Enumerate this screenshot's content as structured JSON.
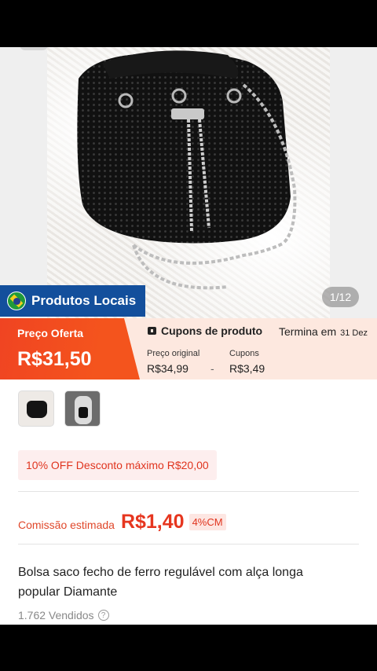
{
  "product_image": {
    "counter": "1/12",
    "local_label": "Produtos Locais",
    "flag_icon": "brazil-flag-icon"
  },
  "offer": {
    "label": "Preço Oferta",
    "price": "R$31,50",
    "coupon_title": "Cupons de produto",
    "ends_label": "Termina em",
    "ends_date": "31 Dez",
    "original_label": "Preço original",
    "original_value": "R$34,99",
    "separator": "-",
    "coupons_label": "Cupons",
    "coupons_value": "R$3,49"
  },
  "discount_tag": "10% OFF Desconto máximo R$20,00",
  "commission": {
    "label": "Comissão estimada",
    "value": "R$1,40",
    "rate": "4%CM"
  },
  "product": {
    "title": "Bolsa saco fecho de ferro regulável com alça longa popular Diamante",
    "sold": "1.762 Vendidos",
    "info_icon": "?"
  },
  "colors": {
    "accent": "#f4541d",
    "local_blue": "#134f9c",
    "commission_red": "#e6361f"
  }
}
